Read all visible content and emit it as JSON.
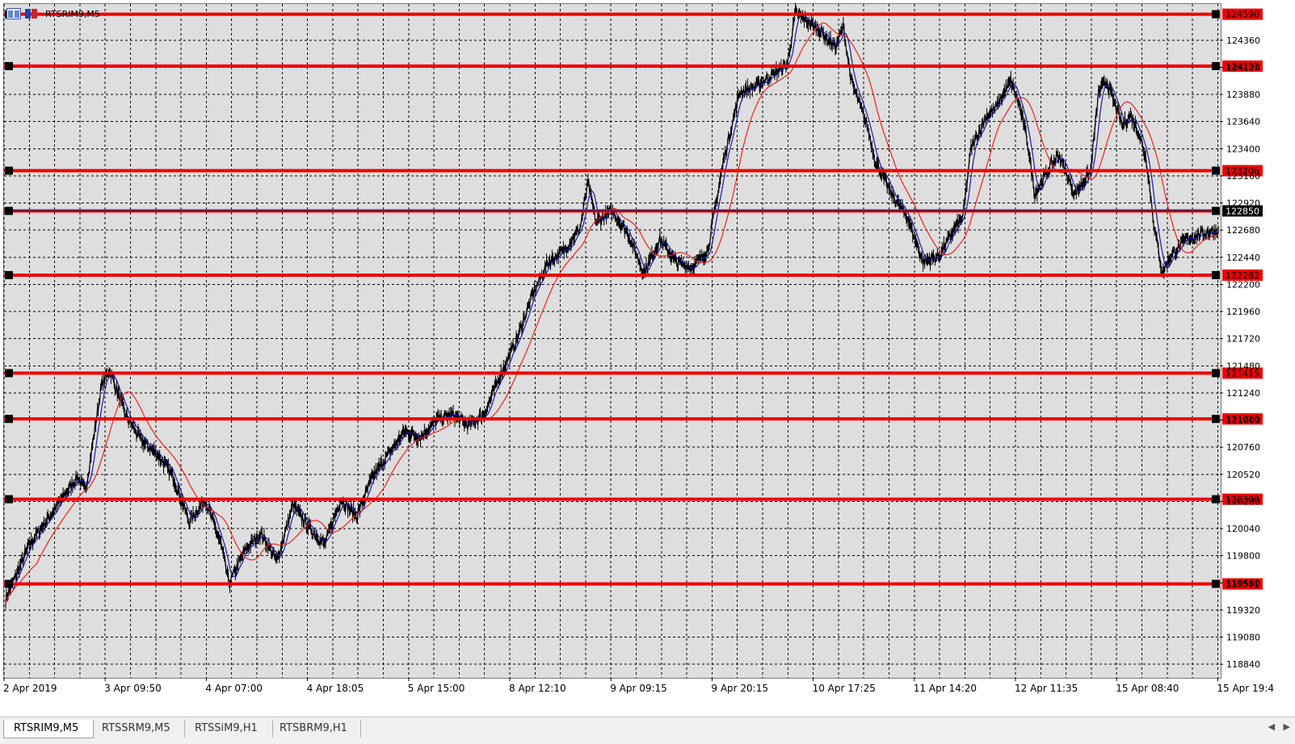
{
  "window": {
    "title": "RTSRIM9,M5",
    "icons": [
      "chart-window-icon",
      "flag-icon"
    ]
  },
  "tabs": [
    {
      "label": "RTSRIM9,M5",
      "active": true
    },
    {
      "label": "RTSSRM9,M5",
      "active": false
    },
    {
      "label": "RTSSiM9,H1",
      "active": false
    },
    {
      "label": "RTSBRM9,H1",
      "active": false
    }
  ],
  "colors": {
    "background": "#dedede",
    "grid": "#000000",
    "level_line": "#ee0000",
    "price": "#000000",
    "ma_fast": "#1a1aaa",
    "ma_slow": "#ee2222",
    "current_price_bg": "#000000"
  },
  "chart_data": {
    "type": "line",
    "symbol": "RTSRIM9",
    "timeframe": "M5",
    "ylim": [
      118720,
      124680
    ],
    "y_ticks": [
      124360,
      124120,
      123880,
      123640,
      123400,
      123160,
      122920,
      122680,
      122440,
      122200,
      121960,
      121720,
      121480,
      121240,
      121000,
      120760,
      120520,
      120280,
      120040,
      119800,
      119560,
      119320,
      119080,
      118840
    ],
    "x_labels": [
      "2 Apr 2019",
      "3 Apr 09:50",
      "4 Apr 07:00",
      "4 Apr 18:05",
      "5 Apr 15:00",
      "8 Apr 12:10",
      "9 Apr 09:15",
      "9 Apr 20:15",
      "10 Apr 17:25",
      "11 Apr 14:20",
      "12 Apr 11:35",
      "15 Apr 08:40",
      "15 Apr 19:4"
    ],
    "levels": [
      {
        "price": 124590,
        "label": "124590"
      },
      {
        "price": 124131,
        "label": "124131"
      },
      {
        "price": 123206,
        "label": "123206"
      },
      {
        "price": 122850,
        "label": "122850",
        "current": true
      },
      {
        "price": 122282,
        "label": "122282"
      },
      {
        "price": 121415,
        "label": "121415"
      },
      {
        "price": 121010,
        "label": "121010"
      },
      {
        "price": 120300,
        "label": "120300"
      },
      {
        "price": 119551,
        "label": "119551"
      }
    ],
    "series": [
      {
        "name": "RTSRIM9",
        "keypoints": [
          [
            0,
            119420
          ],
          [
            3,
            119900
          ],
          [
            6,
            120200
          ],
          [
            9,
            120500
          ],
          [
            10,
            120370
          ],
          [
            12,
            121300
          ],
          [
            13,
            121450
          ],
          [
            15,
            121050
          ],
          [
            17,
            120820
          ],
          [
            19,
            120700
          ],
          [
            21,
            120500
          ],
          [
            23,
            120100
          ],
          [
            25,
            120300
          ],
          [
            27,
            119900
          ],
          [
            28,
            119550
          ],
          [
            30,
            119850
          ],
          [
            32,
            120000
          ],
          [
            34,
            119750
          ],
          [
            36,
            120250
          ],
          [
            38,
            120050
          ],
          [
            40,
            119900
          ],
          [
            42,
            120300
          ],
          [
            44,
            120150
          ],
          [
            46,
            120500
          ],
          [
            48,
            120700
          ],
          [
            50,
            120900
          ],
          [
            52,
            120850
          ],
          [
            54,
            121000
          ],
          [
            56,
            121050
          ],
          [
            58,
            120950
          ],
          [
            60,
            121050
          ],
          [
            62,
            121400
          ],
          [
            64,
            121700
          ],
          [
            66,
            122100
          ],
          [
            68,
            122400
          ],
          [
            70,
            122500
          ],
          [
            72,
            122700
          ],
          [
            73,
            123100
          ],
          [
            74,
            122750
          ],
          [
            76,
            122850
          ],
          [
            78,
            122650
          ],
          [
            80,
            122300
          ],
          [
            82,
            122600
          ],
          [
            84,
            122400
          ],
          [
            86,
            122350
          ],
          [
            88,
            122500
          ],
          [
            89,
            122900
          ],
          [
            90,
            123300
          ],
          [
            92,
            123900
          ],
          [
            94,
            123950
          ],
          [
            96,
            124050
          ],
          [
            98,
            124150
          ],
          [
            99,
            124600
          ],
          [
            100,
            124550
          ],
          [
            102,
            124450
          ],
          [
            104,
            124300
          ],
          [
            105,
            124480
          ],
          [
            106,
            124000
          ],
          [
            108,
            123600
          ],
          [
            109,
            123300
          ],
          [
            111,
            123000
          ],
          [
            113,
            122800
          ],
          [
            115,
            122400
          ],
          [
            117,
            122450
          ],
          [
            119,
            122700
          ],
          [
            120,
            122800
          ],
          [
            121,
            123400
          ],
          [
            123,
            123700
          ],
          [
            124,
            123750
          ],
          [
            126,
            124000
          ],
          [
            127,
            123800
          ],
          [
            128,
            123500
          ],
          [
            129,
            123000
          ],
          [
            131,
            123250
          ],
          [
            132,
            123350
          ],
          [
            134,
            123000
          ],
          [
            136,
            123200
          ],
          [
            137,
            123900
          ],
          [
            138,
            124000
          ],
          [
            140,
            123600
          ],
          [
            141,
            123700
          ],
          [
            142,
            123550
          ],
          [
            143,
            123300
          ],
          [
            144,
            122700
          ],
          [
            145,
            122300
          ],
          [
            146,
            122450
          ],
          [
            148,
            122600
          ],
          [
            150,
            122650
          ],
          [
            152,
            122680
          ]
        ]
      },
      {
        "name": "MA fast",
        "lag": 1
      },
      {
        "name": "MA slow",
        "lag": 4
      }
    ]
  }
}
